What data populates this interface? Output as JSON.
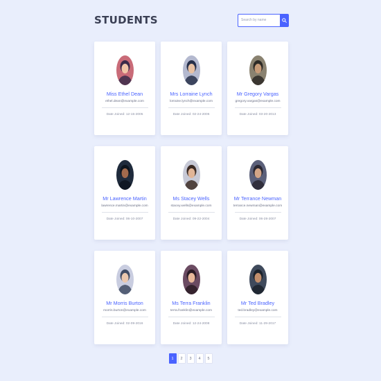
{
  "header": {
    "title": "STUDENTS",
    "search_placeholder": "Search by name"
  },
  "students": [
    {
      "name": "Miss Ethel Dean",
      "email": "ethel.dean@example.com",
      "joined": "Date Joined: 12-15-2005",
      "avatar_colors": [
        "#c96b78",
        "#f1c6a8",
        "#3b2b4a"
      ]
    },
    {
      "name": "Mrs Lorraine Lynch",
      "email": "lorraine.lynch@example.com",
      "joined": "Date Joined: 02-24-2006",
      "avatar_colors": [
        "#b4b9cf",
        "#e8c1a3",
        "#27304a"
      ]
    },
    {
      "name": "Mr Gregory Vargas",
      "email": "gregory.vargas@example.com",
      "joined": "Date Joined: 03-20-2013",
      "avatar_colors": [
        "#8a8270",
        "#c79b78",
        "#2d2a26"
      ]
    },
    {
      "name": "Mr Lawrence Martin",
      "email": "lawrence.martin@example.com",
      "joined": "Date Joined: 06-10-2007",
      "avatar_colors": [
        "#1f2b3c",
        "#a26a4d",
        "#0d141e"
      ]
    },
    {
      "name": "Ms Stacey Wells",
      "email": "stacey.wells@example.com",
      "joined": "Date Joined: 09-22-2004",
      "avatar_colors": [
        "#c7c9d6",
        "#e1b597",
        "#3b2b25"
      ]
    },
    {
      "name": "Mr Terrance Newman",
      "email": "terrance.newman@example.com",
      "joined": "Date Joined: 06-28-2007",
      "avatar_colors": [
        "#5b607a",
        "#d2a587",
        "#2a2732"
      ]
    },
    {
      "name": "Mr Morris Burton",
      "email": "morris.burton@example.com",
      "joined": "Date Joined: 02-09-2016",
      "avatar_colors": [
        "#c9cde0",
        "#eac7ad",
        "#404b63"
      ]
    },
    {
      "name": "Ms Terra Franklin",
      "email": "terra.franklin@example.com",
      "joined": "Date Joined: 12-24-2008",
      "avatar_colors": [
        "#6b4b62",
        "#e7b79a",
        "#2b1c26"
      ]
    },
    {
      "name": "Mr Ted Bradley",
      "email": "ted.bradley@example.com",
      "joined": "Date Joined: 11-29-2017",
      "avatar_colors": [
        "#3f4a5c",
        "#c18e6c",
        "#1b222c"
      ]
    }
  ],
  "pagination": {
    "pages": [
      "1",
      "2",
      "3",
      "4",
      "5"
    ],
    "current": "1"
  },
  "colors": {
    "accent": "#4a63ff",
    "background": "#e9eefc"
  },
  "icons": {
    "search": "magnifier-icon"
  }
}
